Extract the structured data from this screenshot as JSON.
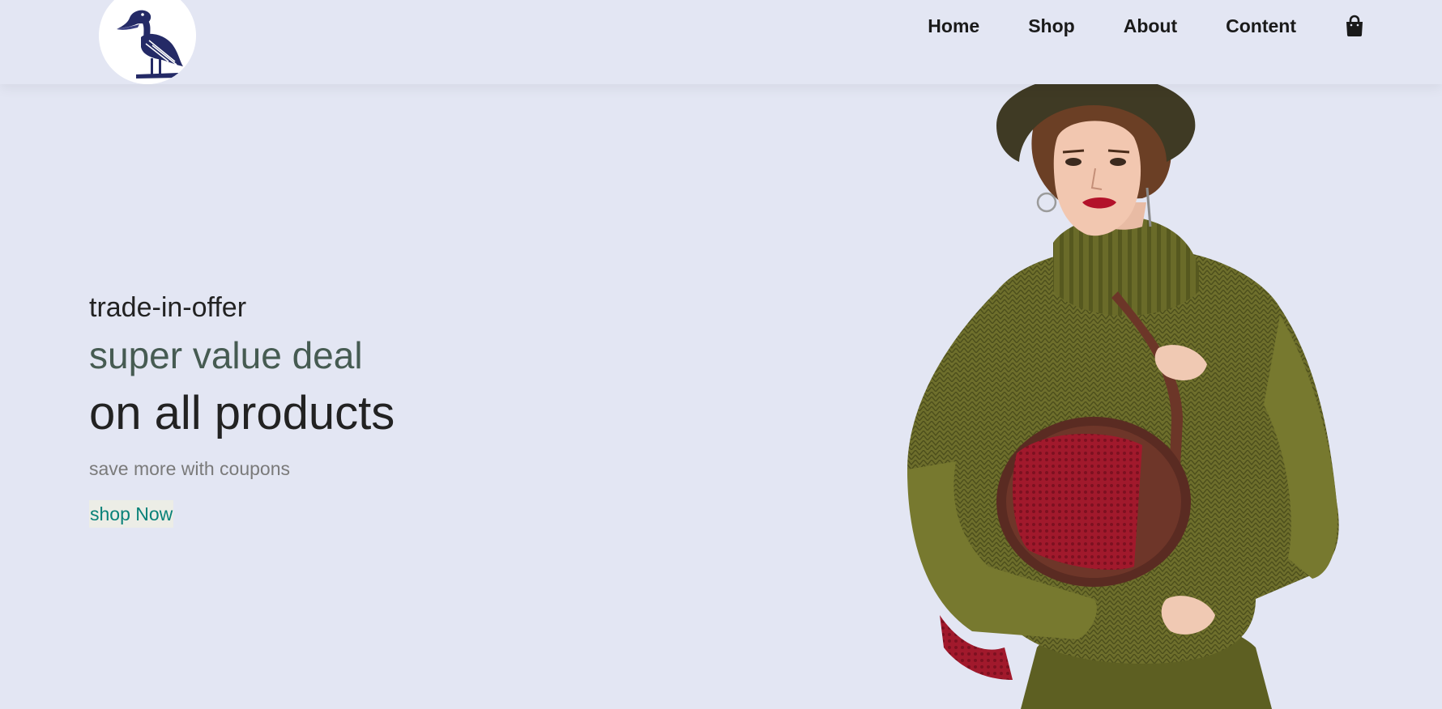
{
  "header": {
    "logo_icon": "pelican-logo-icon",
    "nav": [
      {
        "label": "Home"
      },
      {
        "label": "Shop"
      },
      {
        "label": "About"
      },
      {
        "label": "Content"
      }
    ],
    "cart_icon": "shopping-bag-icon"
  },
  "hero": {
    "eyebrow": "trade-in-offer",
    "subtitle": "super value deal",
    "title": "on all products",
    "tagline": "save more with coupons",
    "cta_label": "shop Now",
    "image": "model-in-green-sweater"
  },
  "colors": {
    "background": "#e3e6f3",
    "accent": "#088178",
    "subtitle": "#465b52",
    "logo": "#242a66"
  }
}
